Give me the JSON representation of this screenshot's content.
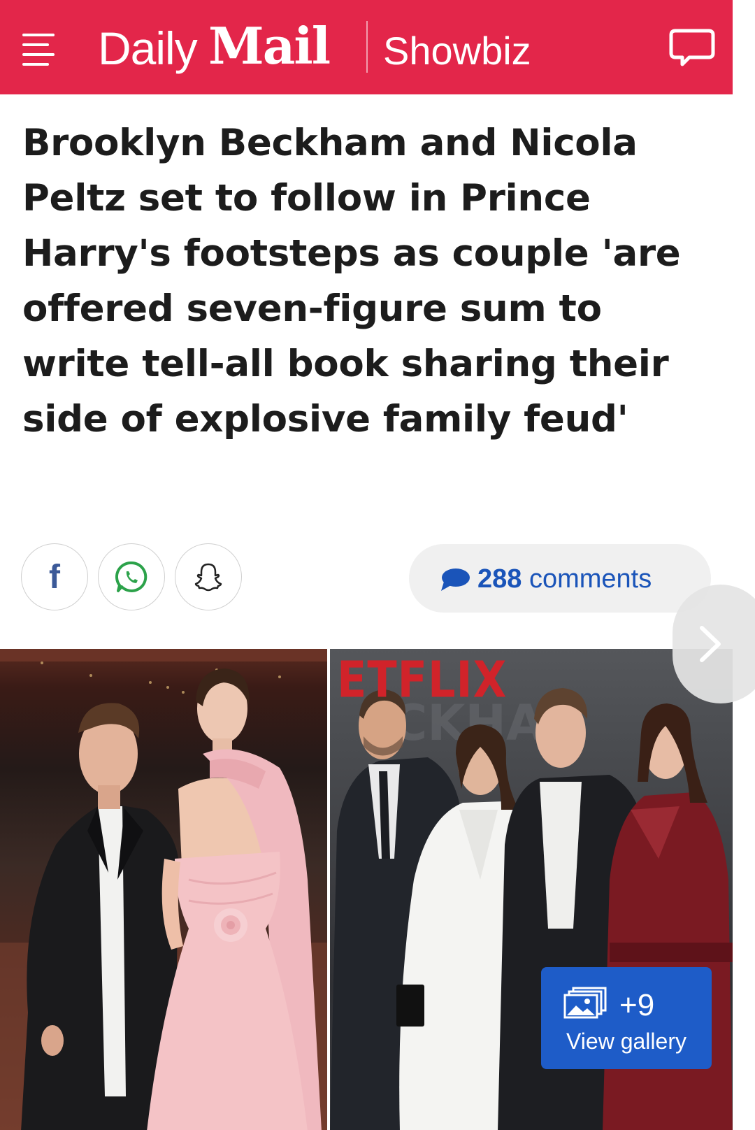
{
  "header": {
    "logo_daily": "Daily",
    "logo_mail": "Mail",
    "section": "Showbiz",
    "brand_color": "#e3264a"
  },
  "article": {
    "headline": "Brooklyn Beckham and Nicola Peltz set to follow in Prince Harry's footsteps as couple 'are offered seven-figure sum to write tell-all book sharing their side of explosive family feud'"
  },
  "share": {
    "buttons": [
      {
        "icon": "facebook-icon",
        "glyph": "f"
      },
      {
        "icon": "whatsapp-icon"
      },
      {
        "icon": "snapchat-icon"
      }
    ]
  },
  "comments": {
    "count": "288",
    "label": "comments",
    "accent": "#1a54b9"
  },
  "media": {
    "right_photo_sign": "ETFLIX",
    "gallery_count": "+9",
    "gallery_label": "View gallery",
    "gallery_color": "#1e5cc8"
  }
}
